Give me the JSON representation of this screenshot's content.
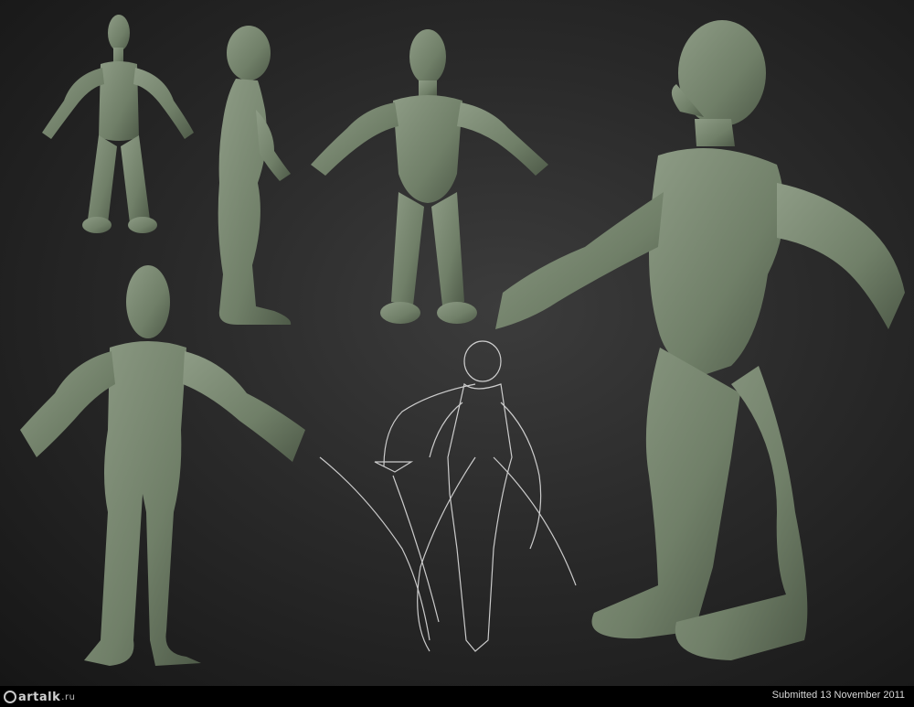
{
  "watermark": {
    "logo_text": "artalk",
    "logo_suffix": ".ru"
  },
  "footer": {
    "submitted_text": "Submitted 13 November 2011"
  },
  "colors": {
    "clay": "#7a8a72",
    "clay_shadow": "#566350",
    "sketch": "#e8e8e8"
  }
}
